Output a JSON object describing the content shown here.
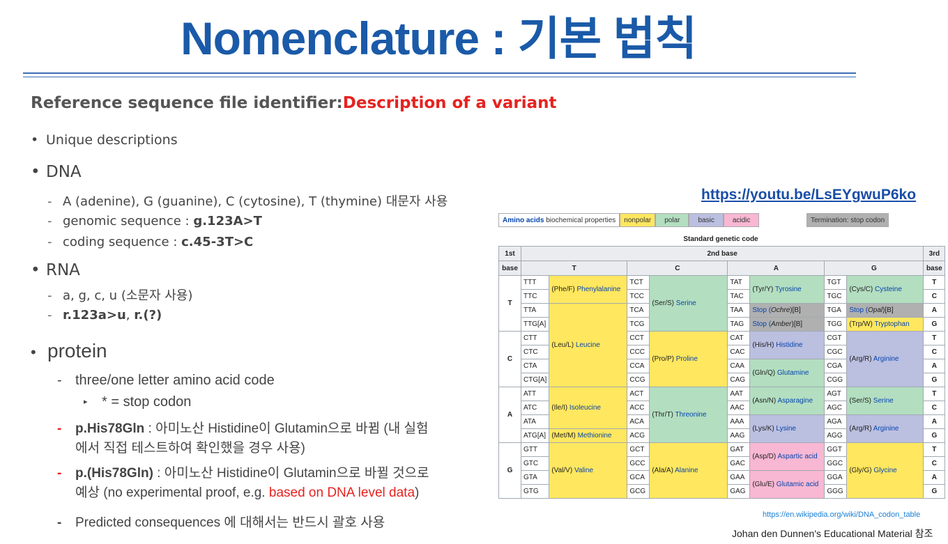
{
  "title": "Nomenclature : 기본 법칙",
  "heading": {
    "main": "Reference sequence file identifier:",
    "highlight": "Description of a variant"
  },
  "bullets": {
    "unique": "Unique descriptions",
    "dna": "DNA",
    "dna_items": [
      "A (adenine), G (guanine), C (cytosine), T (thymine) 대문자 사용",
      "genomic sequence : ",
      "coding sequence : "
    ],
    "dna_bold": [
      "g.123A>T",
      "c.45-3T>C"
    ],
    "rna": "RNA",
    "rna_items": [
      "a, g, c, u (소문자 사용)",
      "r.123a>u",
      ", ",
      "r.(?)"
    ],
    "protein": "protein",
    "protein_items": {
      "code": "three/one letter amino acid code",
      "stop": "* = stop codon",
      "p1_bold": "p.His78Gln",
      "p1_text": " : 아미노산 Histidine이 Glutamin으로 바뀜 (내 실험",
      "p1_text2": "에서 직접 테스트하여 확인했을 경우 사용)",
      "p2_bold": "p.(His78Gln)",
      "p2_text": " : 아미노산 Histidine이 Glutamin으로 바뀔 것으로",
      "p2_text2": "예상 (no experimental proof, e.g. ",
      "p2_red": "based on DNA level data",
      "p2_end": ")",
      "p3": "Predicted consequences 에 대해서는 반드시 괄호 사용"
    }
  },
  "link": "https://youtu.be/LsEYgwuP6ko",
  "legend": {
    "aa": "Amino acids",
    "props": " biochemical properties",
    "nonpolar": "nonpolar",
    "polar": "polar",
    "basic": "basic",
    "acidic": "acidic",
    "term": "Termination: stop codon"
  },
  "table": {
    "title": "Standard genetic code",
    "h_1st": "1st",
    "h_base": "base",
    "h_2nd": "2nd base",
    "h_3rd": "3rd",
    "cols": [
      "T",
      "C",
      "A",
      "G"
    ],
    "rows": [
      "T",
      "C",
      "A",
      "G"
    ],
    "third": [
      "T",
      "C",
      "A",
      "G"
    ],
    "codons": [
      [
        "TTT",
        "TTC",
        "TTA",
        "TTG[A]",
        "TCT",
        "TCC",
        "TCA",
        "TCG",
        "TAT",
        "TAC",
        "TAA",
        "TAG",
        "TGT",
        "TGC",
        "TGA",
        "TGG"
      ],
      [
        "CTT",
        "CTC",
        "CTA",
        "CTG[A]",
        "CCT",
        "CCC",
        "CCA",
        "CCG",
        "CAT",
        "CAC",
        "CAA",
        "CAG",
        "CGT",
        "CGC",
        "CGA",
        "CGG"
      ],
      [
        "ATT",
        "ATC",
        "ATA",
        "ATG[A]",
        "ACT",
        "ACC",
        "ACA",
        "ACG",
        "AAT",
        "AAC",
        "AAA",
        "AAG",
        "AGT",
        "AGC",
        "AGA",
        "AGG"
      ],
      [
        "GTT",
        "GTC",
        "GTA",
        "GTG",
        "GCT",
        "GCC",
        "GCA",
        "GCG",
        "GAT",
        "GAC",
        "GAA",
        "GAG",
        "GGT",
        "GGC",
        "GGA",
        "GGG"
      ]
    ],
    "aa": {
      "phe": [
        "(Phe/F) ",
        "Phenylalanine"
      ],
      "leu": [
        "(Leu/L) ",
        "Leucine"
      ],
      "ser": [
        "(Ser/S) ",
        "Serine"
      ],
      "tyr": [
        "(Tyr/Y) ",
        "Tyrosine"
      ],
      "ochre": [
        "Stop (",
        "Ochre",
        ")[B]"
      ],
      "amber": [
        "Stop (",
        "Amber",
        ")[B]"
      ],
      "cys": [
        "(Cys/C) ",
        "Cysteine"
      ],
      "opal": [
        "Stop (",
        "Opal",
        ")[B]"
      ],
      "trp": [
        "(Trp/W) ",
        "Tryptophan"
      ],
      "pro": [
        "(Pro/P) ",
        "Proline"
      ],
      "his": [
        "(His/H) ",
        "Histidine"
      ],
      "gln": [
        "(Gln/Q) ",
        "Glutamine"
      ],
      "arg": [
        "(Arg/R) ",
        "Arginine"
      ],
      "ile": [
        "(Ile/I) ",
        "Isoleucine"
      ],
      "met": [
        "(Met/M) ",
        "Methionine"
      ],
      "thr": [
        "(Thr/T) ",
        "Threonine"
      ],
      "asn": [
        "(Asn/N) ",
        "Asparagine"
      ],
      "lys": [
        "(Lys/K) ",
        "Lysine"
      ],
      "ser2": [
        "(Ser/S) ",
        "Serine"
      ],
      "arg2": [
        "(Arg/R) ",
        "Arginine"
      ],
      "val": [
        "(Val/V) ",
        "Valine"
      ],
      "ala": [
        "(Ala/A) ",
        "Alanine"
      ],
      "asp": [
        "(Asp/D) ",
        "Aspartic acid"
      ],
      "glu": [
        "(Glu/E) ",
        "Glutamic acid"
      ],
      "gly": [
        "(Gly/G) ",
        "Glycine"
      ]
    }
  },
  "wiki_url": "https://en.wikipedia.org/wiki/DNA_codon_table",
  "credit": "Johan den Dunnen's Educational Material 참조",
  "colors": {
    "title": "#1a5aa8",
    "red": "#e52320",
    "nonpolar": "#ffe75f",
    "polar": "#b3dec0",
    "basic": "#bbbfe0",
    "acidic": "#f8b7d3",
    "stop": "#b0b0b0"
  }
}
